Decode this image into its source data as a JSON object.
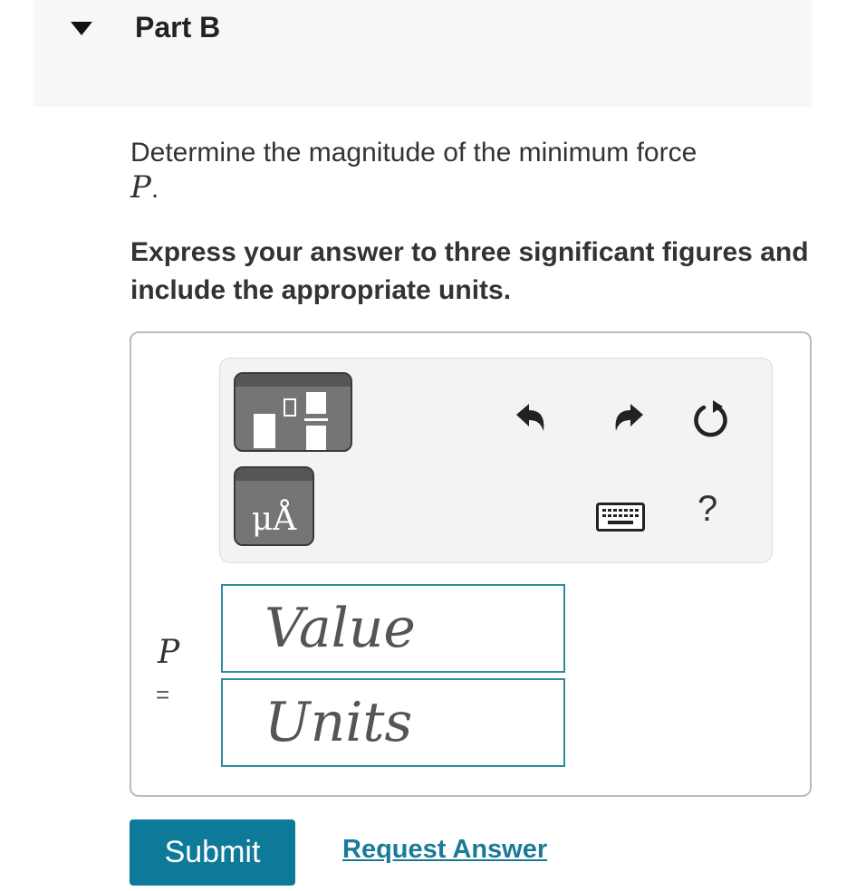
{
  "part": {
    "title": "Part B"
  },
  "question": {
    "text": "Determine the magnitude of the minimum force",
    "variable": "P",
    "period": "."
  },
  "instruction": "Express your answer to three significant figures and include the appropriate units.",
  "toolbar": {
    "units_button_label": "μÅ",
    "help_label": "?",
    "icons": [
      "templates-icon",
      "units-icon",
      "undo-icon",
      "redo-icon",
      "reset-icon",
      "keyboard-icon",
      "help-icon"
    ]
  },
  "answer": {
    "variable": "P",
    "equals": "=",
    "value_placeholder": "Value",
    "units_placeholder": "Units"
  },
  "actions": {
    "submit_label": "Submit",
    "request_answer_label": "Request Answer"
  },
  "colors": {
    "accent": "#0e7a9a",
    "field_border": "#2f8ba0",
    "link": "#1c7a99"
  }
}
